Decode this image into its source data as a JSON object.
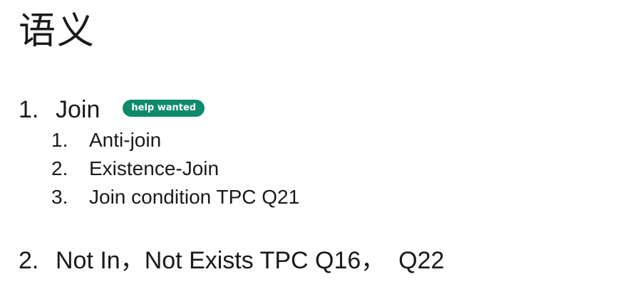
{
  "title": "语义",
  "items": [
    {
      "number": "1.",
      "text": "Join",
      "badge": "help wanted",
      "subitems": [
        {
          "number": "1.",
          "text": "Anti-join"
        },
        {
          "number": "2.",
          "text": "Existence-Join"
        },
        {
          "number": "3.",
          "text": "Join condition TPC Q21"
        }
      ]
    },
    {
      "number": "2.",
      "text": "Not In，Not Exists TPC Q16，  Q22"
    }
  ],
  "colors": {
    "badge_background": "#0e8a6c",
    "badge_text": "#ffffff",
    "text": "#1a1a1a",
    "background": "#ffffff"
  }
}
